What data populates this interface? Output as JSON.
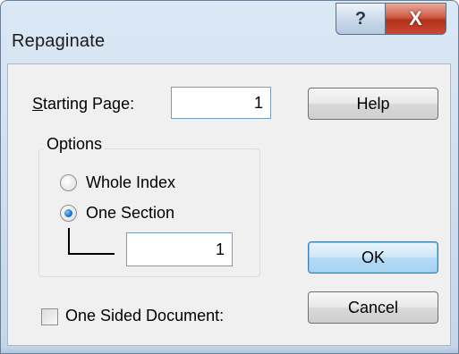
{
  "window": {
    "title": "Repaginate",
    "help_caption_glyph": "?",
    "close_caption_glyph": "X"
  },
  "starting_page": {
    "label_accel": "S",
    "label_rest": "tarting Page:",
    "value": "1"
  },
  "options": {
    "legend": "Options",
    "whole_index": {
      "label": "Whole Index",
      "selected": false
    },
    "one_section": {
      "label": "One Section",
      "selected": true
    },
    "section_value": "1"
  },
  "one_sided": {
    "label": "One Sided Document:",
    "checked": false
  },
  "buttons": {
    "help": "Help",
    "ok": "OK",
    "cancel": "Cancel"
  },
  "colors": {
    "title_bar": "#cfdfef",
    "close_button": "#c8432d",
    "dialog_face": "#f0f0f0",
    "default_button_border": "#3c7fb1"
  }
}
